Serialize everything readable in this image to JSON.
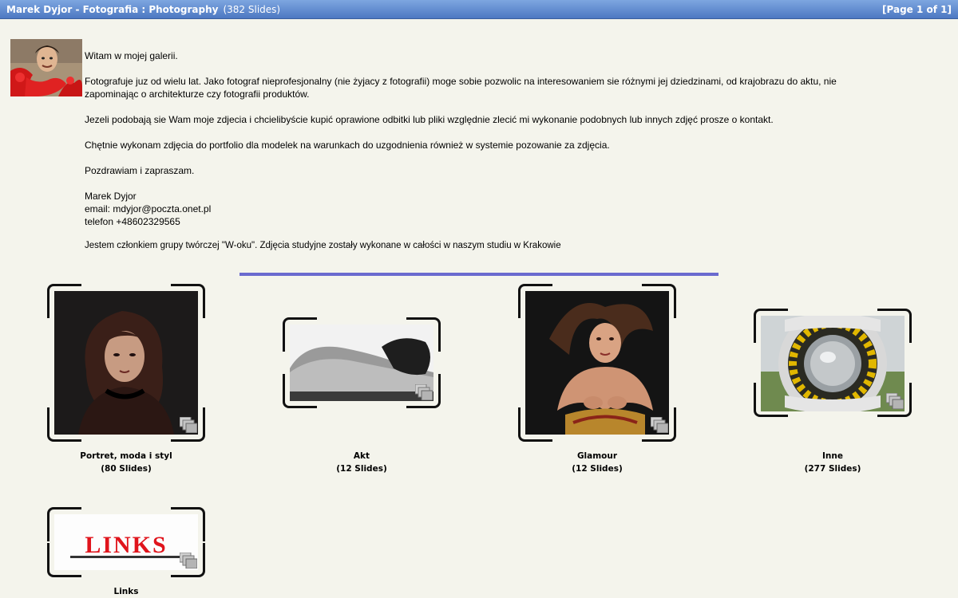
{
  "header": {
    "title": "Marek Dyjor - Fotografia : Photography",
    "slide_count": "(382 Slides)",
    "page_info": "[Page 1 of 1]"
  },
  "intro": {
    "greeting": "Witam w mojej galerii.",
    "para1": "Fotografuje juz od wielu lat. Jako fotograf nieprofesjonalny (nie żyjacy z fotografii) moge sobie pozwolic na interesowaniem sie różnymi jej dziedzinami, od krajobrazu do aktu, nie zapominając o architekturze czy fotografii produktów.",
    "para2": "Jezeli podobają sie Wam moje zdjecia i chcielibyście kupić oprawione odbitki lub pliki względnie zlecić mi wykonanie podobnych lub innych zdjęć prosze o kontakt.",
    "para3": "Chętnie wykonam zdjęcia do portfolio dla modelek na warunkach do uzgodnienia również w systemie pozowanie za zdjęcia.",
    "para4": "Pozdrawiam i zapraszam.",
    "name": "Marek Dyjor",
    "email": "email: mdyjor@poczta.onet.pl",
    "phone": "telefon +48602329565",
    "member": "Jestem członkiem grupy twórczej \"W-oku\". Zdjęcia studyjne zostały wykonane w całości w naszym studiu w Krakowie"
  },
  "albums": [
    {
      "name": "Portret, moda i styl",
      "count": "(80 Slides)"
    },
    {
      "name": "Akt",
      "count": "(12 Slides)"
    },
    {
      "name": "Glamour",
      "count": "(12 Slides)"
    },
    {
      "name": "Inne",
      "count": "(277 Slides)"
    },
    {
      "name": "Links",
      "count": "",
      "thumb_text": "LINKS"
    }
  ],
  "colors": {
    "titlebar": "#5b86cc",
    "background": "#f4f4ec",
    "divider": "#6a6acf"
  }
}
